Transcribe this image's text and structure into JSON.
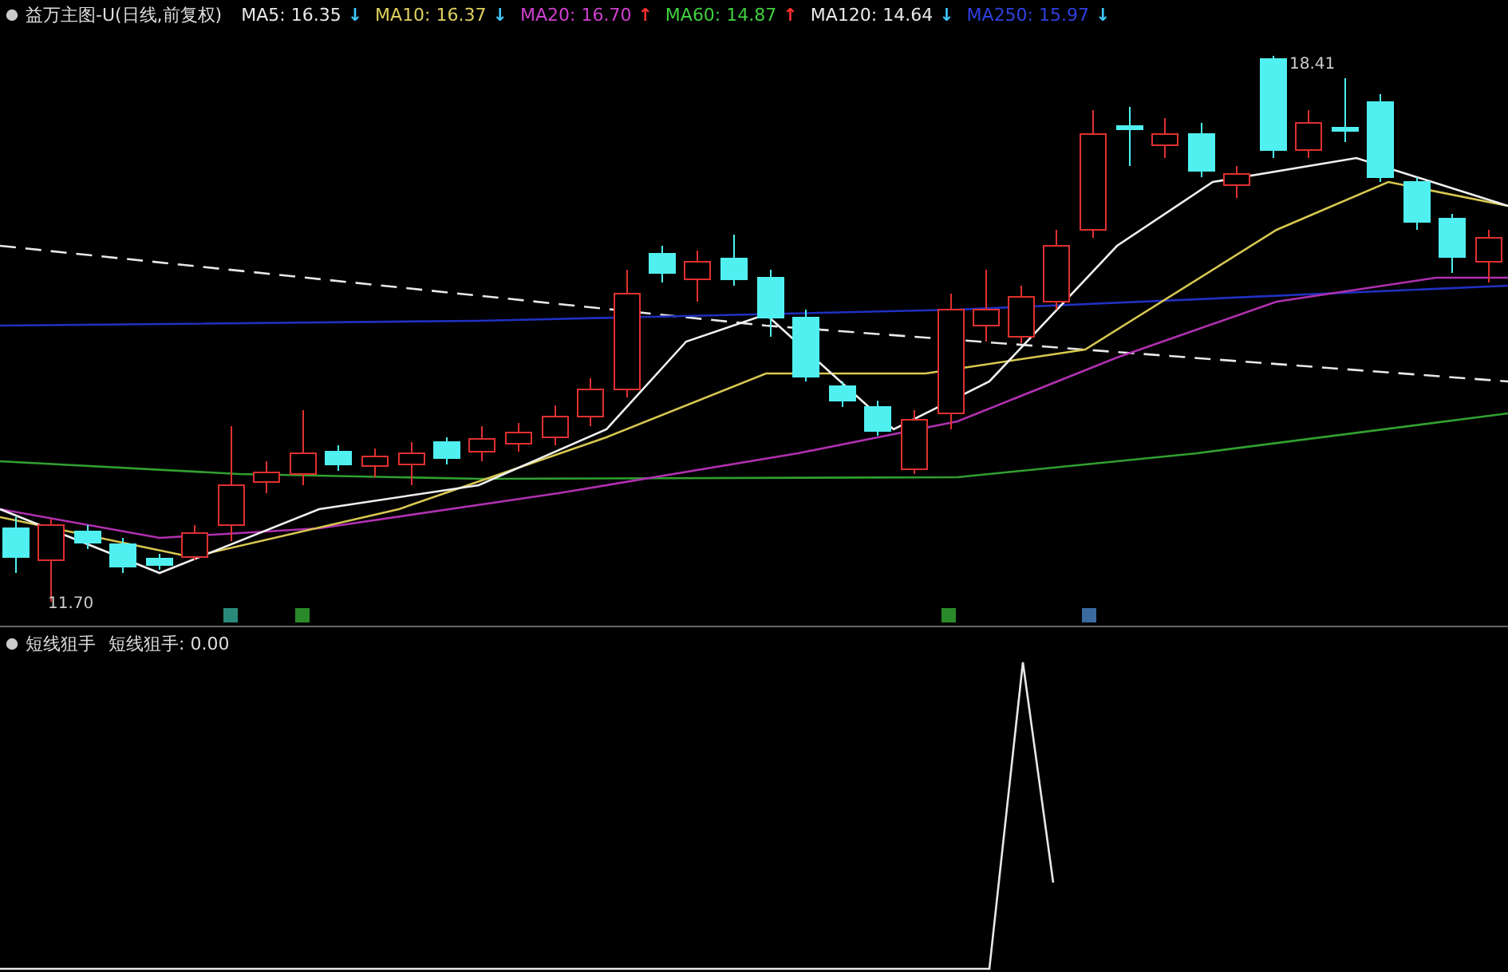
{
  "main_panel": {
    "title": "益万主图-U(日线,前复权)",
    "legend": [
      {
        "label": "MA5:",
        "value": "16.35",
        "arrow": "↓",
        "rising": false,
        "color": "#e8e8e8"
      },
      {
        "label": "MA10:",
        "value": "16.37",
        "arrow": "↓",
        "rising": false,
        "color": "#e0d060"
      },
      {
        "label": "MA20:",
        "value": "16.70",
        "arrow": "↑",
        "rising": true,
        "color": "#d040d0"
      },
      {
        "label": "MA60:",
        "value": "14.87",
        "arrow": "↑",
        "rising": true,
        "color": "#40d040"
      },
      {
        "label": "MA120:",
        "value": "14.64",
        "arrow": "↓",
        "rising": false,
        "color": "#e8e8e8"
      },
      {
        "label": "MA250:",
        "value": "15.97",
        "arrow": "↓",
        "rising": false,
        "color": "#3040e0"
      }
    ],
    "high_label": "18.41",
    "low_label": "11.70",
    "markers": [
      {
        "color": "#2a8a7a"
      },
      {
        "color": "#2a8a2a"
      },
      {
        "color": "#2a8a2a"
      },
      {
        "color": "#3a6aa0"
      }
    ]
  },
  "sub_panel": {
    "title": "短线狙手",
    "reading": "短线狙手: 0.00"
  }
}
